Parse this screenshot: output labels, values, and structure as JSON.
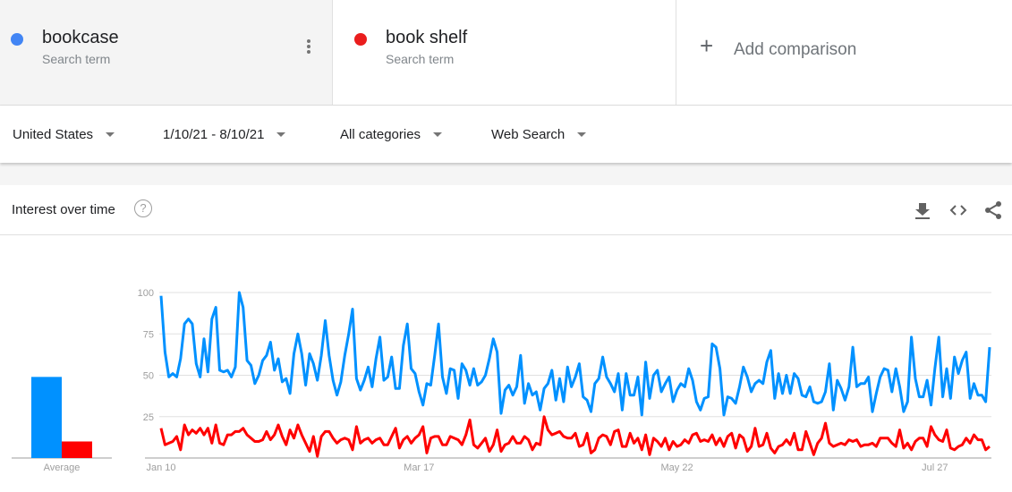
{
  "terms": [
    {
      "name": "bookcase",
      "type": "Search term",
      "color": "#4285f4"
    },
    {
      "name": "book shelf",
      "type": "Search term",
      "color": "#ea1d1d"
    }
  ],
  "add_comparison": "Add comparison",
  "filters": {
    "region": "United States",
    "date_range": "1/10/21 - 8/10/21",
    "category": "All categories",
    "property": "Web Search"
  },
  "card": {
    "title": "Interest over time",
    "help_icon": "question-circle-icon",
    "actions": [
      "download-icon",
      "embed-code-icon",
      "share-icon"
    ]
  },
  "chart_data": [
    {
      "type": "bar",
      "categories": [
        "Average"
      ],
      "series": [
        {
          "name": "bookcase",
          "values": [
            49
          ],
          "color": "#0091ff"
        },
        {
          "name": "book shelf",
          "values": [
            10
          ],
          "color": "#ff0000"
        }
      ],
      "xlabel": "Average"
    },
    {
      "type": "line",
      "ylim": [
        0,
        100
      ],
      "yticks": [
        25,
        50,
        75,
        100
      ],
      "grid": true,
      "xticks": [
        {
          "index": 0,
          "label": "Jan 10"
        },
        {
          "index": 66,
          "label": "Mar 17"
        },
        {
          "index": 132,
          "label": "May 22"
        },
        {
          "index": 198,
          "label": "Jul 27"
        }
      ],
      "x_range": [
        "Jan 10",
        "Aug 10"
      ],
      "series": [
        {
          "name": "bookcase",
          "color": "#0091ff",
          "values": [
            98,
            64,
            49,
            51,
            49,
            60,
            81,
            84,
            81,
            57,
            49,
            72,
            52,
            84,
            91,
            53,
            52,
            53,
            49,
            55,
            100,
            91,
            59,
            56,
            45,
            50,
            59,
            62,
            70,
            53,
            60,
            46,
            48,
            39,
            63,
            75,
            63,
            44,
            63,
            57,
            47,
            62,
            83,
            62,
            47,
            38,
            46,
            62,
            75,
            90,
            48,
            41,
            47,
            55,
            43,
            60,
            73,
            47,
            49,
            61,
            42,
            42,
            68,
            81,
            54,
            51,
            40,
            32,
            45,
            44,
            62,
            81,
            49,
            39,
            54,
            53,
            36,
            57,
            53,
            44,
            54,
            44,
            46,
            50,
            60,
            72,
            64,
            27,
            41,
            44,
            38,
            43,
            62,
            33,
            45,
            38,
            40,
            29,
            42,
            45,
            53,
            35,
            48,
            34,
            55,
            43,
            49,
            57,
            37,
            35,
            28,
            45,
            48,
            61,
            49,
            45,
            40,
            51,
            29,
            51,
            38,
            38,
            49,
            26,
            58,
            36,
            50,
            53,
            40,
            45,
            49,
            34,
            41,
            45,
            43,
            54,
            47,
            34,
            29,
            36,
            37,
            69,
            67,
            54,
            26,
            37,
            36,
            33,
            43,
            55,
            49,
            40,
            45,
            47,
            45,
            58,
            65,
            36,
            51,
            39,
            50,
            39,
            51,
            48,
            38,
            37,
            43,
            34,
            33,
            34,
            40,
            57,
            29,
            47,
            42,
            35,
            43,
            67,
            43,
            45,
            45,
            49,
            28,
            39,
            49,
            54,
            53,
            40,
            54,
            43,
            28,
            34,
            73,
            48,
            37,
            37,
            47,
            32,
            54,
            73,
            37,
            54,
            36,
            61,
            51,
            59,
            64,
            36,
            45,
            38,
            38,
            34,
            67
          ]
        },
        {
          "name": "book shelf",
          "color": "#ff0000",
          "values": [
            18,
            8,
            9,
            10,
            13,
            5,
            20,
            14,
            17,
            15,
            18,
            14,
            18,
            9,
            20,
            9,
            8,
            14,
            14,
            16,
            16,
            18,
            14,
            12,
            10,
            10,
            11,
            16,
            11,
            14,
            20,
            13,
            8,
            17,
            12,
            20,
            14,
            9,
            4,
            13,
            1,
            13,
            16,
            16,
            12,
            9,
            11,
            12,
            11,
            5,
            19,
            9,
            11,
            12,
            9,
            11,
            12,
            8,
            8,
            13,
            18,
            6,
            11,
            13,
            9,
            12,
            14,
            19,
            3,
            12,
            13,
            13,
            8,
            8,
            13,
            12,
            11,
            8,
            14,
            23,
            8,
            6,
            9,
            12,
            4,
            8,
            17,
            4,
            8,
            9,
            13,
            9,
            9,
            13,
            11,
            5,
            9,
            8,
            25,
            17,
            14,
            15,
            16,
            13,
            12,
            12,
            15,
            7,
            8,
            15,
            3,
            5,
            12,
            14,
            13,
            8,
            16,
            17,
            7,
            7,
            15,
            9,
            12,
            5,
            14,
            2,
            12,
            10,
            7,
            12,
            5,
            10,
            7,
            8,
            11,
            9,
            14,
            15,
            10,
            11,
            10,
            14,
            8,
            12,
            7,
            13,
            15,
            6,
            14,
            12,
            4,
            7,
            18,
            7,
            8,
            15,
            6,
            3,
            7,
            8,
            11,
            8,
            15,
            5,
            5,
            16,
            9,
            2,
            9,
            12,
            21,
            9,
            7,
            8,
            9,
            8,
            11,
            10,
            11,
            7,
            8,
            8,
            9,
            7,
            12,
            12,
            12,
            9,
            7,
            17,
            6,
            9,
            5,
            10,
            12,
            12,
            7,
            19,
            14,
            11,
            10,
            17,
            6,
            5,
            7,
            8,
            12,
            9,
            14,
            11,
            11,
            5,
            7
          ]
        }
      ]
    }
  ]
}
